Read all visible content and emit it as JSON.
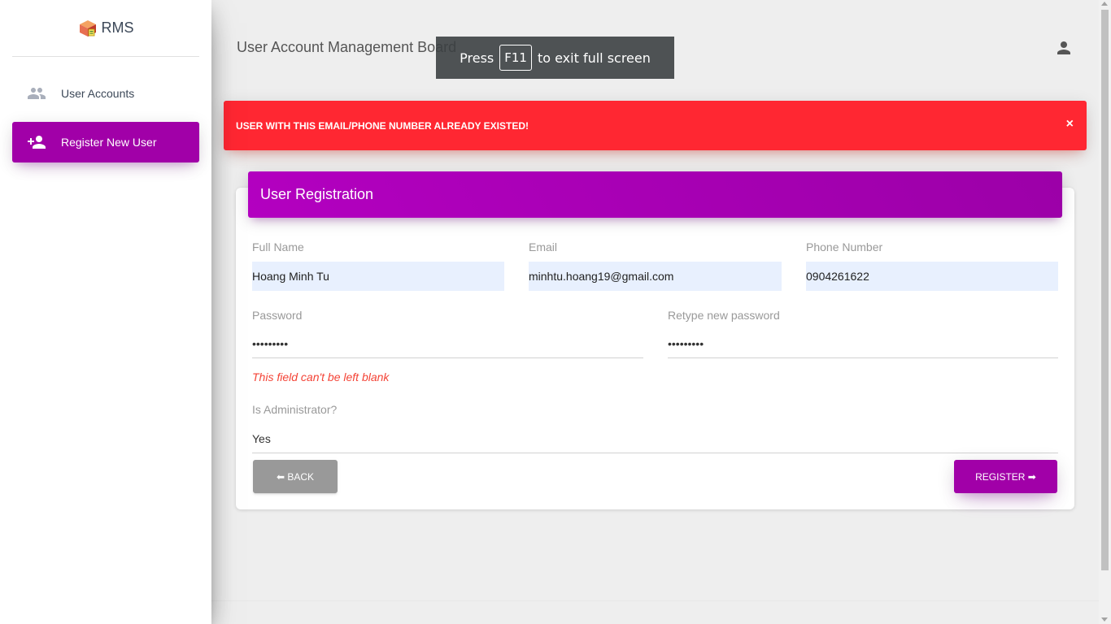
{
  "app": {
    "logo_text": "RMS",
    "logo_icon": "box-icon"
  },
  "sidebar": {
    "items": [
      {
        "label": "User Accounts",
        "icon": "people-icon",
        "active": false
      },
      {
        "label": "Register New User",
        "icon": "person-add-icon",
        "active": true
      }
    ]
  },
  "header": {
    "title": "User Account Management Board",
    "account_icon": "person-icon"
  },
  "fullscreen_toast": {
    "prefix": "Press",
    "key": "F11",
    "suffix": "to exit full screen"
  },
  "alert": {
    "message": "USER WITH THIS EMAIL/PHONE NUMBER ALREADY EXISTED!",
    "close": "×",
    "color": "#ff2732"
  },
  "form": {
    "title": "User Registration",
    "full_name": {
      "label": "Full Name",
      "value": "Hoang Minh Tu"
    },
    "email": {
      "label": "Email",
      "value": "minhtu.hoang19@gmail.com"
    },
    "phone": {
      "label": "Phone Number",
      "value": "0904261622"
    },
    "password": {
      "label": "Password",
      "value": "•••••••••",
      "error": "This field can't be left blank"
    },
    "retype_password": {
      "label": "Retype new password",
      "value": "•••••••••"
    },
    "is_admin": {
      "label": "Is Administrator?",
      "value": "Yes"
    },
    "back_button": "⬅ BACK",
    "register_button": "REGISTER ➡"
  },
  "colors": {
    "accent": "#a100a8",
    "error": "#f44336",
    "autofill_bg": "#e8f0fe"
  }
}
